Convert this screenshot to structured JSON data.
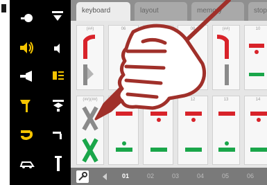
{
  "tabs": [
    {
      "label": "keyboard",
      "active": true
    },
    {
      "label": "layout",
      "active": false
    },
    {
      "label": "memory",
      "active": false
    },
    {
      "label": "stop",
      "active": false
    }
  ],
  "tiles_top": [
    {
      "number": "(##)",
      "type": "signal-red"
    },
    {
      "number": "06",
      "type": "signal-red"
    },
    {
      "number": "07",
      "type": "signal-red"
    },
    {
      "number": "08",
      "type": "signal-red"
    },
    {
      "number": "(##)",
      "type": "signal-red"
    },
    {
      "number": "10",
      "type": "signal-green"
    }
  ],
  "tiles_bottom": [
    {
      "number": "(##)(##)",
      "type": "turnout"
    },
    {
      "number": "10",
      "type": "signal"
    },
    {
      "number": "11",
      "type": "signal"
    },
    {
      "number": "12",
      "type": "signal"
    },
    {
      "number": "13",
      "type": "signal"
    },
    {
      "number": "14",
      "type": "signal"
    }
  ],
  "bottom_bar": {
    "pages": [
      "01",
      "02",
      "03",
      "04",
      "05",
      "06"
    ],
    "active_page": "01"
  },
  "overlay": {
    "icon": "hand-writing-pen-icon"
  },
  "colors": {
    "sidebar_icon": "#f5c400",
    "red": "#d8232a",
    "green": "#1aa64a",
    "overlay": "#a0302a"
  }
}
